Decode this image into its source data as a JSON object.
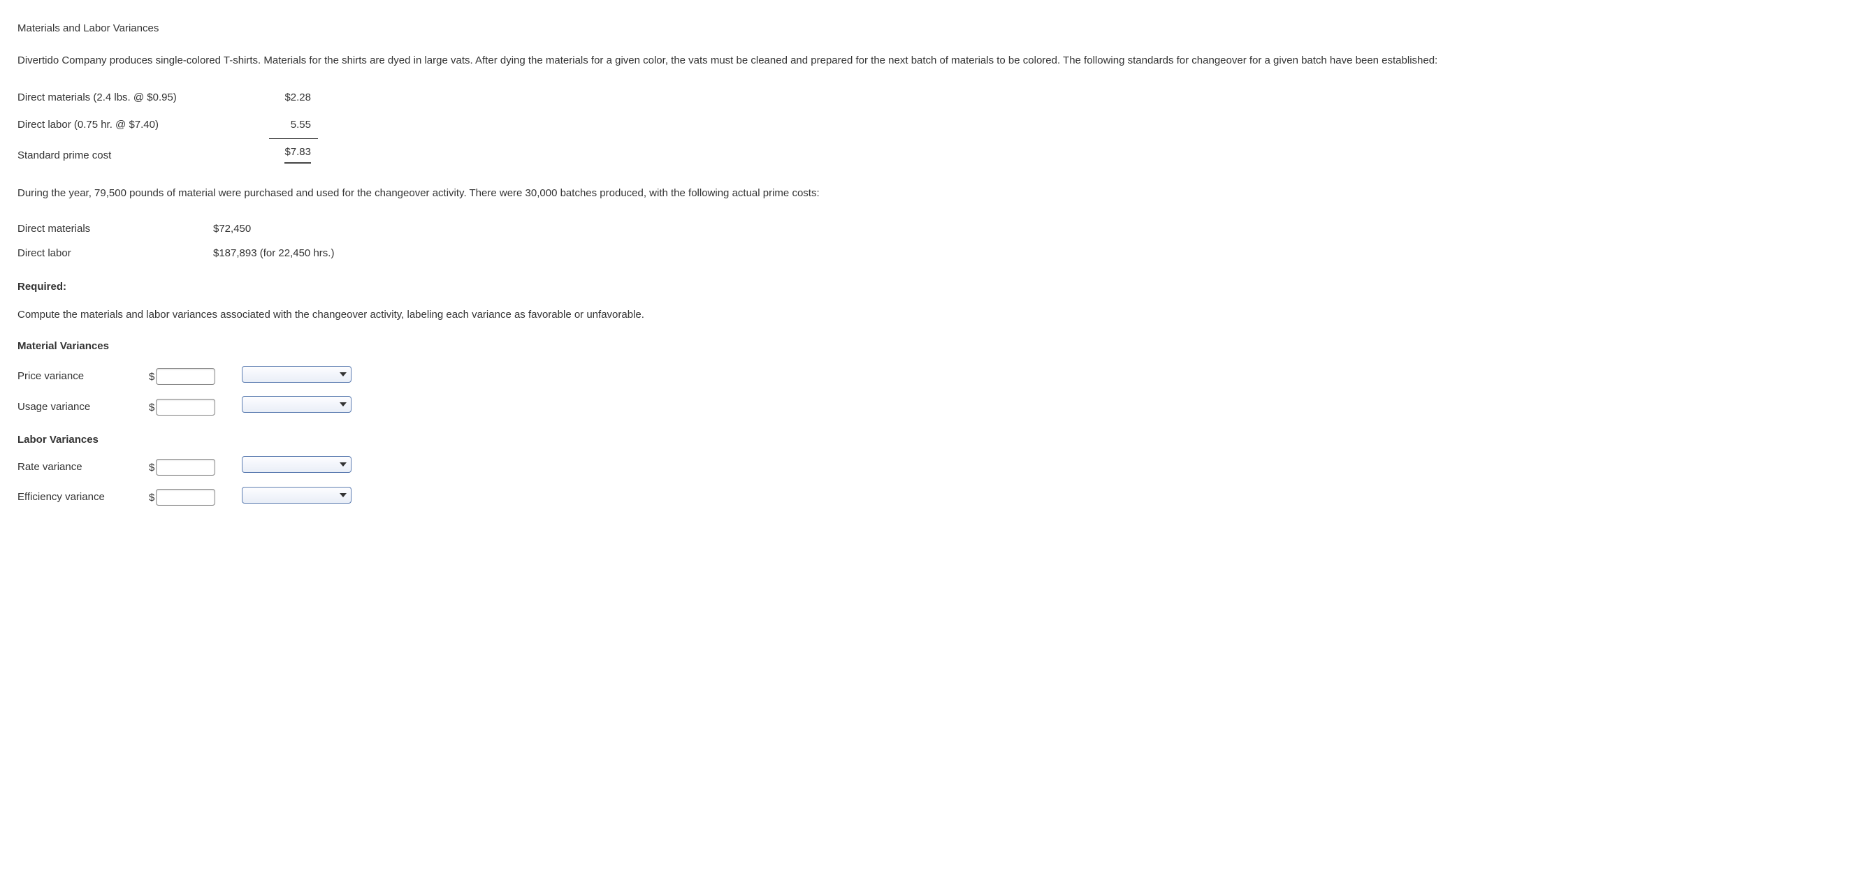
{
  "title": "Materials and Labor Variances",
  "intro": "Divertido Company produces single-colored T-shirts. Materials for the shirts are dyed in large vats. After dying the materials for a given color, the vats must be cleaned and prepared for the next batch of materials to be colored. The following standards for changeover for a given batch have been established:",
  "standards": {
    "dm_label": "Direct materials (2.4 lbs. @ $0.95)",
    "dm_value": "$2.28",
    "dl_label": "Direct labor (0.75 hr. @ $7.40)",
    "dl_value": "5.55",
    "spc_label": "Standard prime cost",
    "spc_value": "$7.83"
  },
  "during": "During the year, 79,500 pounds of material were purchased and used for the changeover activity. There were 30,000 batches produced, with the following actual prime costs:",
  "actual": {
    "dm_label": "Direct materials",
    "dm_value": "$72,450",
    "dl_label": "Direct labor",
    "dl_value": "$187,893 (for 22,450 hrs.)"
  },
  "required_label": "Required:",
  "required_text": "Compute the materials and labor variances associated with the changeover activity, labeling each variance as favorable or unfavorable.",
  "material_variances_header": "Material Variances",
  "labor_variances_header": "Labor Variances",
  "rows": {
    "price": "Price variance",
    "usage": "Usage variance",
    "rate": "Rate variance",
    "efficiency": "Efficiency variance"
  },
  "currency": "$"
}
